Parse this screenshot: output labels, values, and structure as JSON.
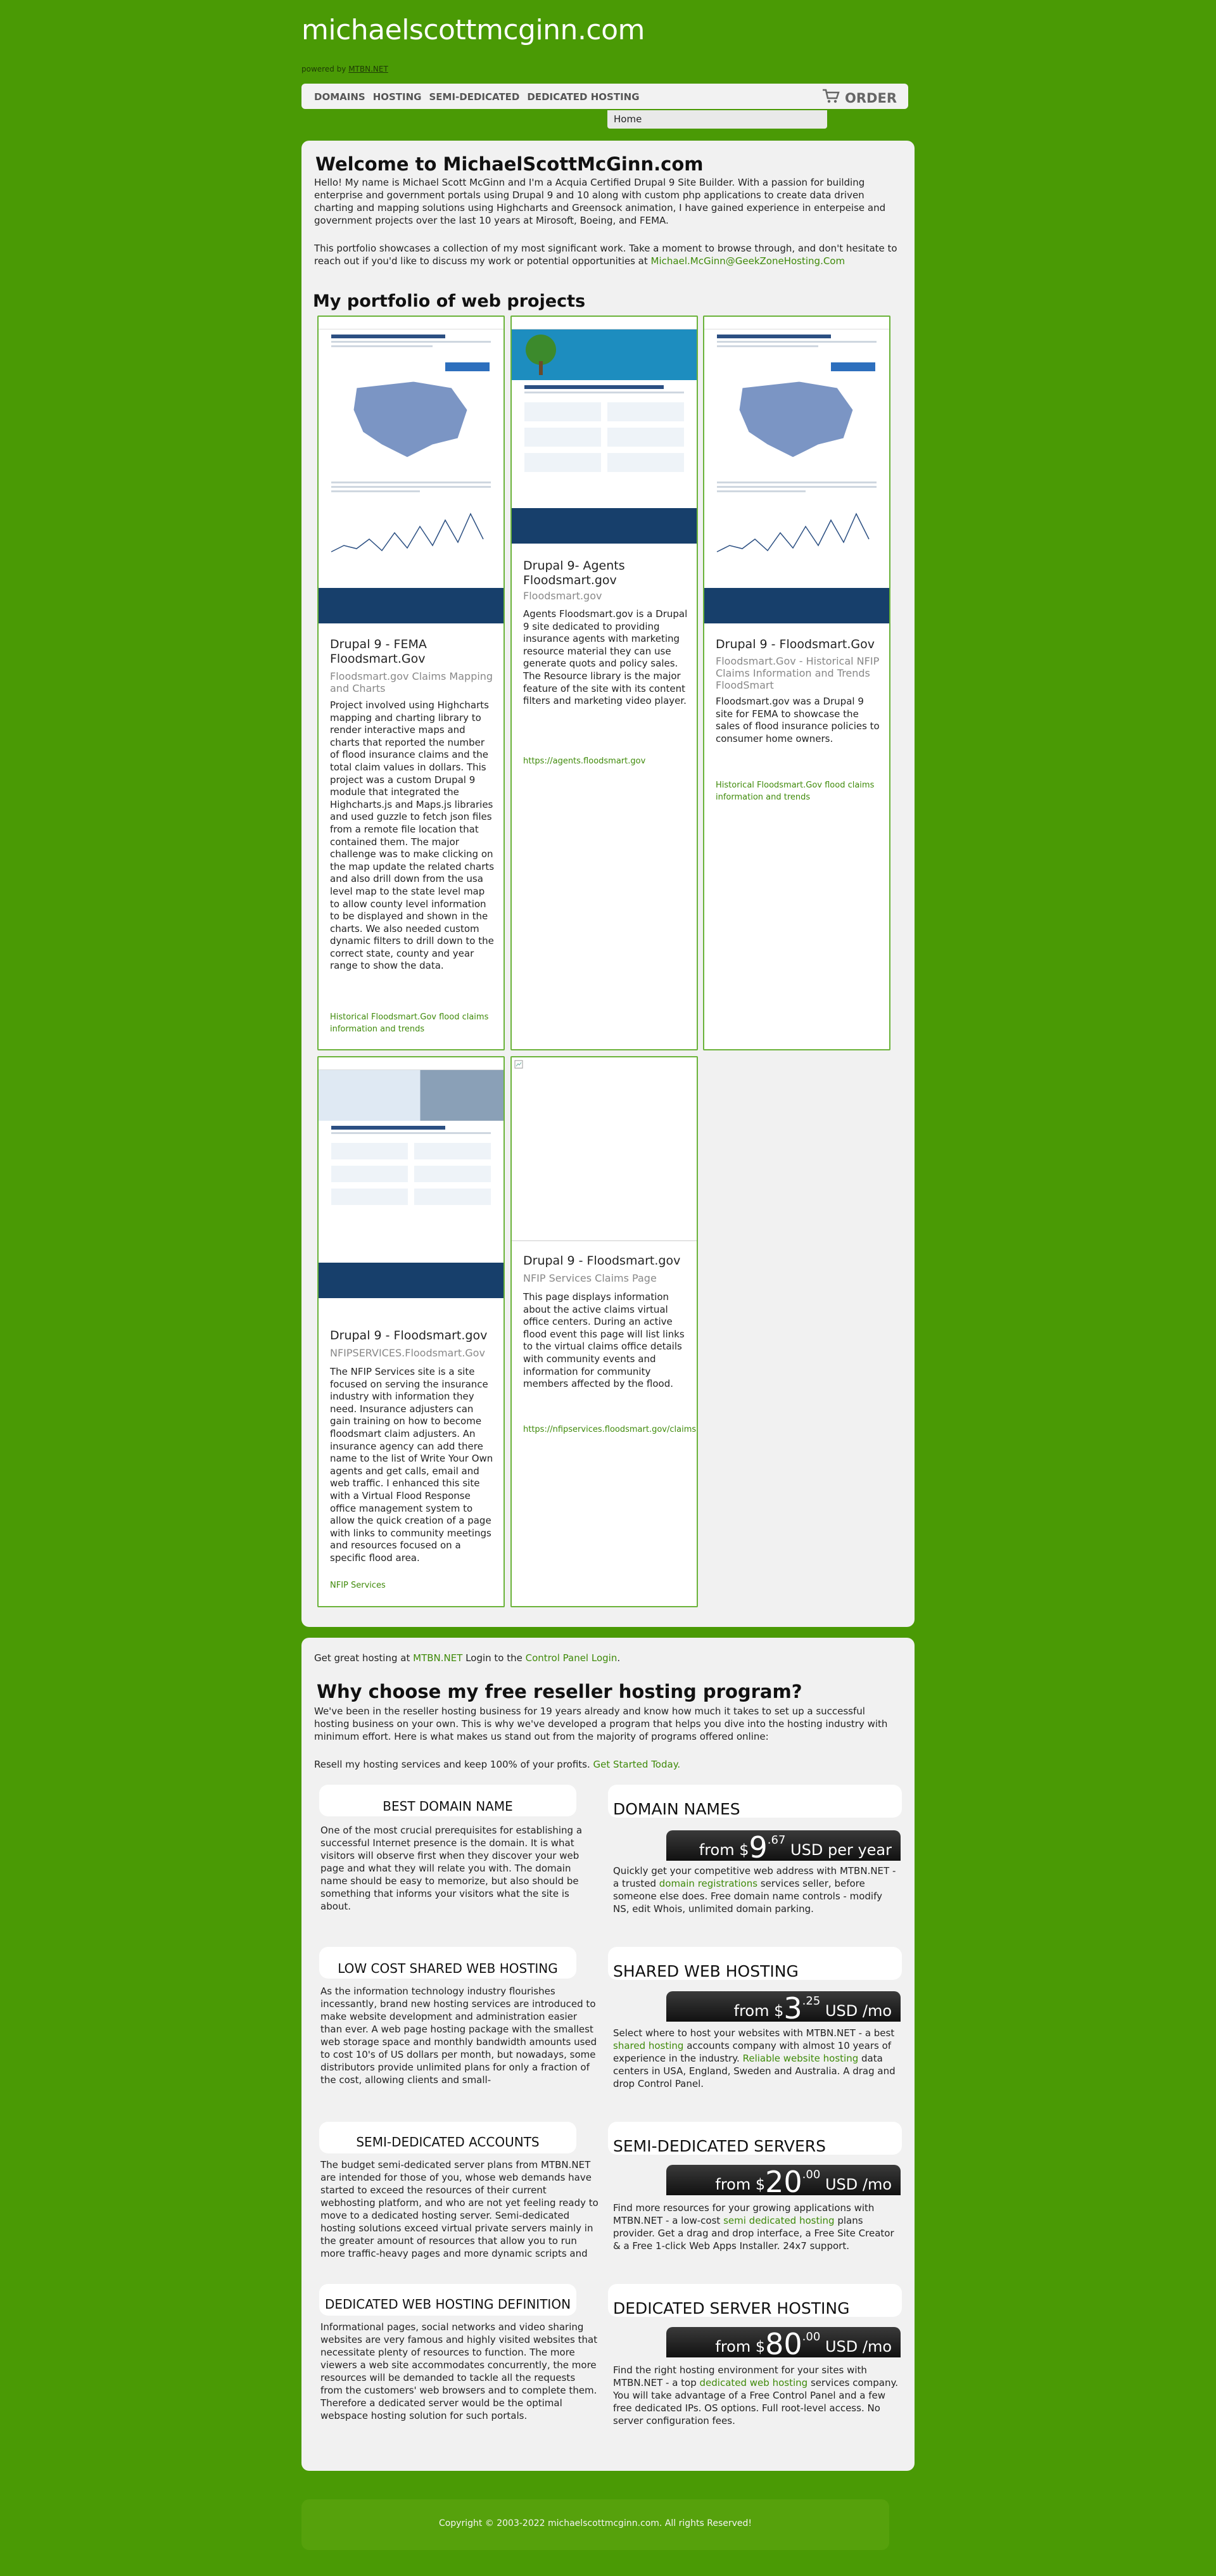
{
  "header": {
    "site_title": "michaelscottmcginn.com",
    "powered_prefix": "powered by",
    "powered_link": "MTBN.NET"
  },
  "nav": {
    "items": [
      "DOMAINS",
      "HOSTING",
      "SEMI-DEDICATED",
      "DEDICATED HOSTING"
    ],
    "order_label": "ORDER",
    "dropdown_item": "Home"
  },
  "welcome": {
    "title": "Welcome to MichaelScottMcGinn.com",
    "p1": "Hello! My name is Michael Scott McGinn and I'm a Acquia Certified Drupal 9 Site Builder. With a passion for building enterprise and government portals using Drupal 9 and 10 along with custom php applications to create data driven charting and mapping solutions using Highcharts and Greensock animation, I have gained experience in enterpeise and government projects over the last 10 years at Mirosoft, Boeing, and FEMA.",
    "p2_text": "This portfolio showcases a collection of my most significant work. Take a moment to browse through, and don't hesitate to reach out if you'd like to discuss my work or potential opportunities at",
    "p2_email": "Michael.McGinn@GeekZoneHosting.Com"
  },
  "portfolio": {
    "heading": "My portfolio of web projects",
    "cards": [
      {
        "title": "Drupal 9 - FEMA Floodsmart.Gov",
        "subtitle": "Floodsmart.gov Claims Mapping and Charts",
        "body": "Project involved using Highcharts mapping and charting library to render interactive maps and charts that reported the number of flood insurance claims and the total claim values in dollars.  This project was a custom Drupal 9 module that integrated the Highcharts.js and Maps.js libraries and used guzzle to fetch json files from a remote file location that contained them. The major challenge was to make clicking on the map update the related charts and also drill down from the usa level map to the state level map to allow county level information to be displayed and shown in the charts.  We also needed custom dynamic filters to drill down to the correct state, county and year range to show the data.",
        "link": "Historical Floodsmart.Gov flood claims information and trends"
      },
      {
        "title": "Drupal 9- Agents Floodsmart.gov",
        "subtitle": "Floodsmart.gov",
        "body": "Agents Floodsmart.gov is a Drupal 9 site dedicated to providing insurance agents with marketing resource material they can use generate quots and policy sales. The Resource library is the major feature of the site with its content filters and marketing video player.",
        "link": "https://agents.floodsmart.gov"
      },
      {
        "title": "Drupal 9 - Floodsmart.Gov",
        "subtitle": "Floodsmart.Gov - Historical NFIP Claims Information and Trends FloodSmart",
        "body": "Floodsmart.gov was a Drupal 9 site for FEMA to showcase the sales of flood insurance policies to consumer home owners.",
        "link": "Historical Floodsmart.Gov flood claims information and trends"
      },
      {
        "title": "Drupal 9 - Floodsmart.gov",
        "subtitle": "NFIPSERVICES.Floodsmart.Gov",
        "body": "The NFIP Services site is a site focused on serving the insurance industry with information they need.  Insurance adjusters can gain training on how to become floodsmart claim adjusters. An insurance agency can add there name to the list of Write Your Own agents and get calls, email and web traffic. I enhanced this site with a Virtual Flood Response office management system to allow the quick creation of a page with links to community meetings and resources focused on a specific flood area.",
        "link": "NFIP Services"
      },
      {
        "title": "Drupal 9 - Floodsmart.gov",
        "subtitle": "NFIP Services Claims Page",
        "body": "This page displays information about the active claims virtual office centers. During an active flood event this page will list links to the virtual claims office details with community events and information for community members affected by the flood.",
        "link": "https://nfipservices.floodsmart.gov/claims"
      }
    ]
  },
  "hosting": {
    "line1_prefix": "Get great hosting at",
    "line1_link1": "MTBN.NET",
    "line1_mid": "Login to the",
    "line1_link2": "Control Panel Login",
    "heading": "Why choose my free reseller hosting program?",
    "intro": "We've been in the reseller hosting business for 19 years already and know how much it takes to set up a successful hosting business on your own. This is why we've developed a program that helps you dive into the hosting industry with minimum effort. Here is what makes us stand out from the majority of programs offered online:",
    "resell_text": "Resell my hosting services and keep 100% of your profits.",
    "resell_link": "Get Started Today.",
    "left_blocks": [
      {
        "title": "BEST DOMAIN NAME",
        "body": "One of the most crucial prerequisites for establishing a successful Internet presence is the domain. It is what visitors will observe first when they discover your web page and what they will relate you with. The domain name should be easy to memorize, but also should be something that informs your visitors what the site is about."
      },
      {
        "title": "LOW COST SHARED WEB HOSTING",
        "body": "As the information technology industry flourishes incessantly, brand new hosting services are introduced to make website development and administration easier than ever. A web page hosting package with the smallest web storage space and monthly bandwidth amounts used to cost 10's of US dollars per month, but nowadays, some distributors provide unlimited plans for only a fraction of the cost, allowing clients and small-"
      },
      {
        "title": "SEMI-DEDICATED ACCOUNTS",
        "body": "The budget semi-dedicated server plans from MTBN.NET are intended for those of you, whose web demands have started to exceed the resources of their current webhosting platform, and who are not yet feeling ready to move to a dedicated hosting server. Semi-dedicated hosting solutions exceed virtual private servers mainly in the greater amount of resources that allow you to run more traffic-heavy pages and more dynamic scripts and"
      },
      {
        "title": "DEDICATED WEB HOSTING DEFINITION",
        "body": "Informational pages, social networks and video sharing websites are very famous and highly visited websites that necessitate plenty of resources to function. The more viewers a web site accommodates concurrently, the more resources will be demanded to tackle all the requests from the customers' web browsers and to complete them. Therefore a dedicated server would be the optimal webspace hosting solution for such portals."
      }
    ],
    "right_blocks": [
      {
        "title": "DOMAIN NAMES",
        "price_from": "from $",
        "price_big": "9",
        "price_cents": ".67",
        "price_unit": " USD per year",
        "body_a": "Quickly get your competitive web address with MTBN.NET - a trusted",
        "body_link": "domain registrations",
        "body_b": "services seller, before someone else does. Free domain name controls - modify NS, edit Whois, unlimited domain parking."
      },
      {
        "title": "SHARED WEB HOSTING",
        "price_from": "from $",
        "price_big": "3",
        "price_cents": ".25",
        "price_unit": " USD /mo",
        "body_a": "Select where to host your websites with MTBN.NET - a best",
        "body_link": "shared hosting",
        "body_b": "accounts company with almost 10 years of experience in the industry.",
        "body_link2": "Reliable website hosting",
        "body_c": "data centers in USA, England, Sweden and Australia. A drag and drop Control Panel."
      },
      {
        "title": "SEMI-DEDICATED SERVERS",
        "price_from": "from $",
        "price_big": "20",
        "price_cents": ".00",
        "price_unit": " USD /mo",
        "body_a": "Find more resources for your growing applications with MTBN.NET - a low-cost",
        "body_link": "semi dedicated hosting",
        "body_b": "plans provider. Get a drag and drop interface, a Free Site Creator & a Free 1-click Web Apps Installer. 24x7 support."
      },
      {
        "title": "DEDICATED SERVER HOSTING",
        "price_from": "from $",
        "price_big": "80",
        "price_cents": ".00",
        "price_unit": " USD /mo",
        "body_a": "Find the right hosting environment for your sites with MTBN.NET - a top",
        "body_link": "dedicated web hosting",
        "body_b": "services company. You will take advantage of a Free Control Panel and a few free dedicated IPs. OS options. Full root-level access. No server configuration fees."
      }
    ]
  },
  "footer": {
    "text": "Copyright © 2003-2022 michaelscottmcginn.com.  All rights Reserved!"
  },
  "colors": {
    "background": "#4a9a05",
    "link": "#3f8a0a",
    "card_border": "#6bb33a",
    "price_bar": "#1a1a1a"
  }
}
